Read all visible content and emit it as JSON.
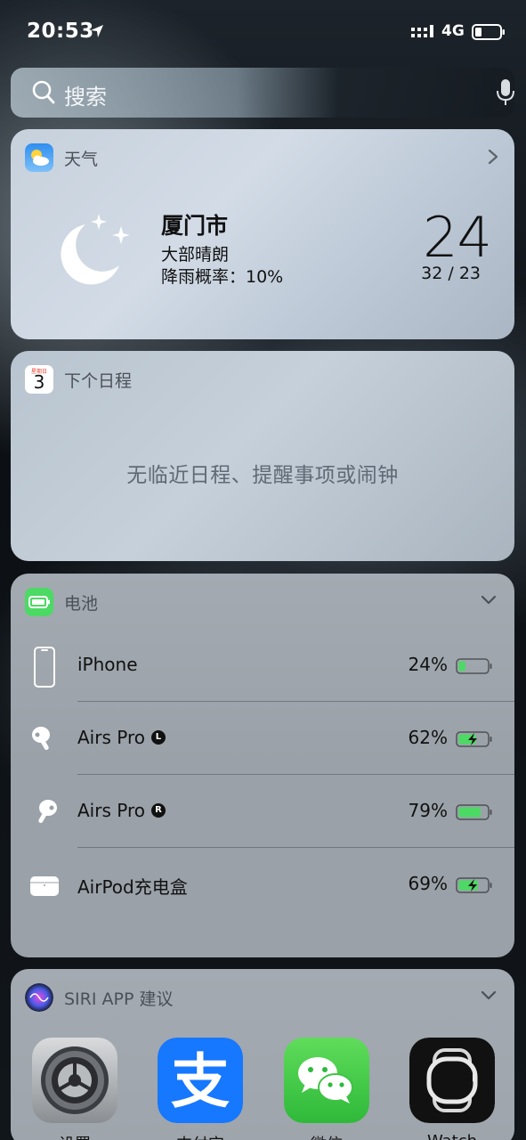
{
  "status_bar": {
    "time": "20:53",
    "network": "4G",
    "icons": [
      "location-icon",
      "signal-icon",
      "battery-icon"
    ]
  },
  "search": {
    "placeholder": "搜索",
    "icons": [
      "search-icon",
      "microphone-icon"
    ]
  },
  "weather": {
    "title": "天气",
    "city": "厦门市",
    "condition": "大部晴朗",
    "rain_chance": "降雨概率：10%",
    "temperature": "24",
    "high_low": "32 / 23",
    "icon": "moon-stars-icon"
  },
  "calendar": {
    "title": "下个日程",
    "icon_day_label": "星期日",
    "icon_date": "3",
    "empty_message": "无临近日程、提醒事项或闹钟"
  },
  "battery": {
    "title": "电池",
    "colors": {
      "green": "#4cd964",
      "charging": "#4cd964"
    },
    "devices": [
      {
        "name": "iPhone",
        "badge": "",
        "percent": "24%",
        "level": 0.24,
        "charging": false,
        "icon": "iphone-icon"
      },
      {
        "name": "Airs Pro",
        "badge": "L",
        "percent": "62%",
        "level": 0.62,
        "charging": true,
        "icon": "airpod-left-icon"
      },
      {
        "name": "Airs Pro",
        "badge": "R",
        "percent": "79%",
        "level": 0.79,
        "charging": false,
        "icon": "airpod-right-icon"
      },
      {
        "name": "AirPod充电盒",
        "badge": "",
        "percent": "69%",
        "level": 0.69,
        "charging": true,
        "icon": "airpod-case-icon"
      }
    ]
  },
  "siri": {
    "title": "SIRI APP 建议",
    "apps": [
      {
        "label": "设置",
        "icon": "settings-icon"
      },
      {
        "label": "支付宝",
        "icon": "alipay-icon"
      },
      {
        "label": "微信",
        "icon": "wechat-icon"
      },
      {
        "label": "Watch",
        "icon": "watch-icon"
      }
    ]
  }
}
